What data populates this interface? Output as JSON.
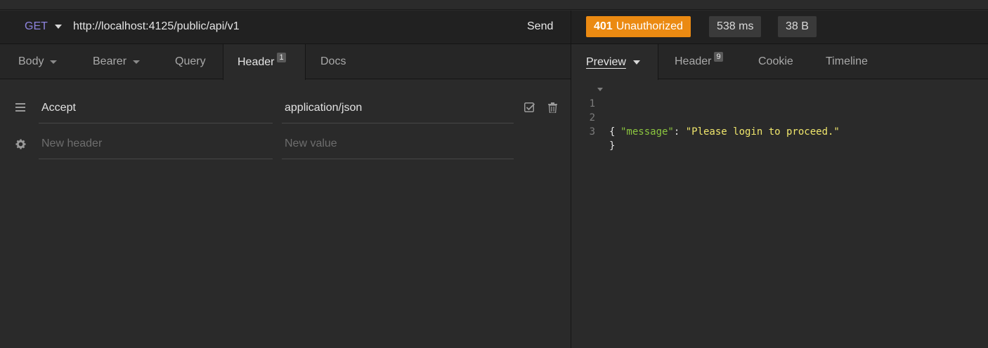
{
  "request": {
    "method": "GET",
    "url": "http://localhost:4125/public/api/v1",
    "send_label": "Send",
    "tabs": [
      {
        "label": "Body",
        "dropdown": true
      },
      {
        "label": "Bearer",
        "dropdown": true
      },
      {
        "label": "Query"
      },
      {
        "label": "Header",
        "badge": "1",
        "active": true
      },
      {
        "label": "Docs"
      }
    ],
    "headers": [
      {
        "name": "Accept",
        "value": "application/json"
      }
    ],
    "new_header_placeholder": "New header",
    "new_value_placeholder": "New value"
  },
  "response": {
    "status_code": "401",
    "status_text": "Unauthorized",
    "time": "538 ms",
    "size": "38 B",
    "tabs": [
      {
        "label": "Preview",
        "active": true,
        "dropdown": true
      },
      {
        "label": "Header",
        "badge": "9"
      },
      {
        "label": "Cookie"
      },
      {
        "label": "Timeline"
      }
    ],
    "body_lines": [
      {
        "no": "1",
        "text": "{"
      },
      {
        "no": "2",
        "key": "\"message\"",
        "sep": ": ",
        "value": "\"Please login to proceed.\""
      },
      {
        "no": "3",
        "text": "}"
      }
    ]
  },
  "colors": {
    "status_accent": "#eb8a12",
    "method_color": "#8e84de",
    "json_key": "#8cc63f",
    "json_string": "#f0e66c"
  }
}
